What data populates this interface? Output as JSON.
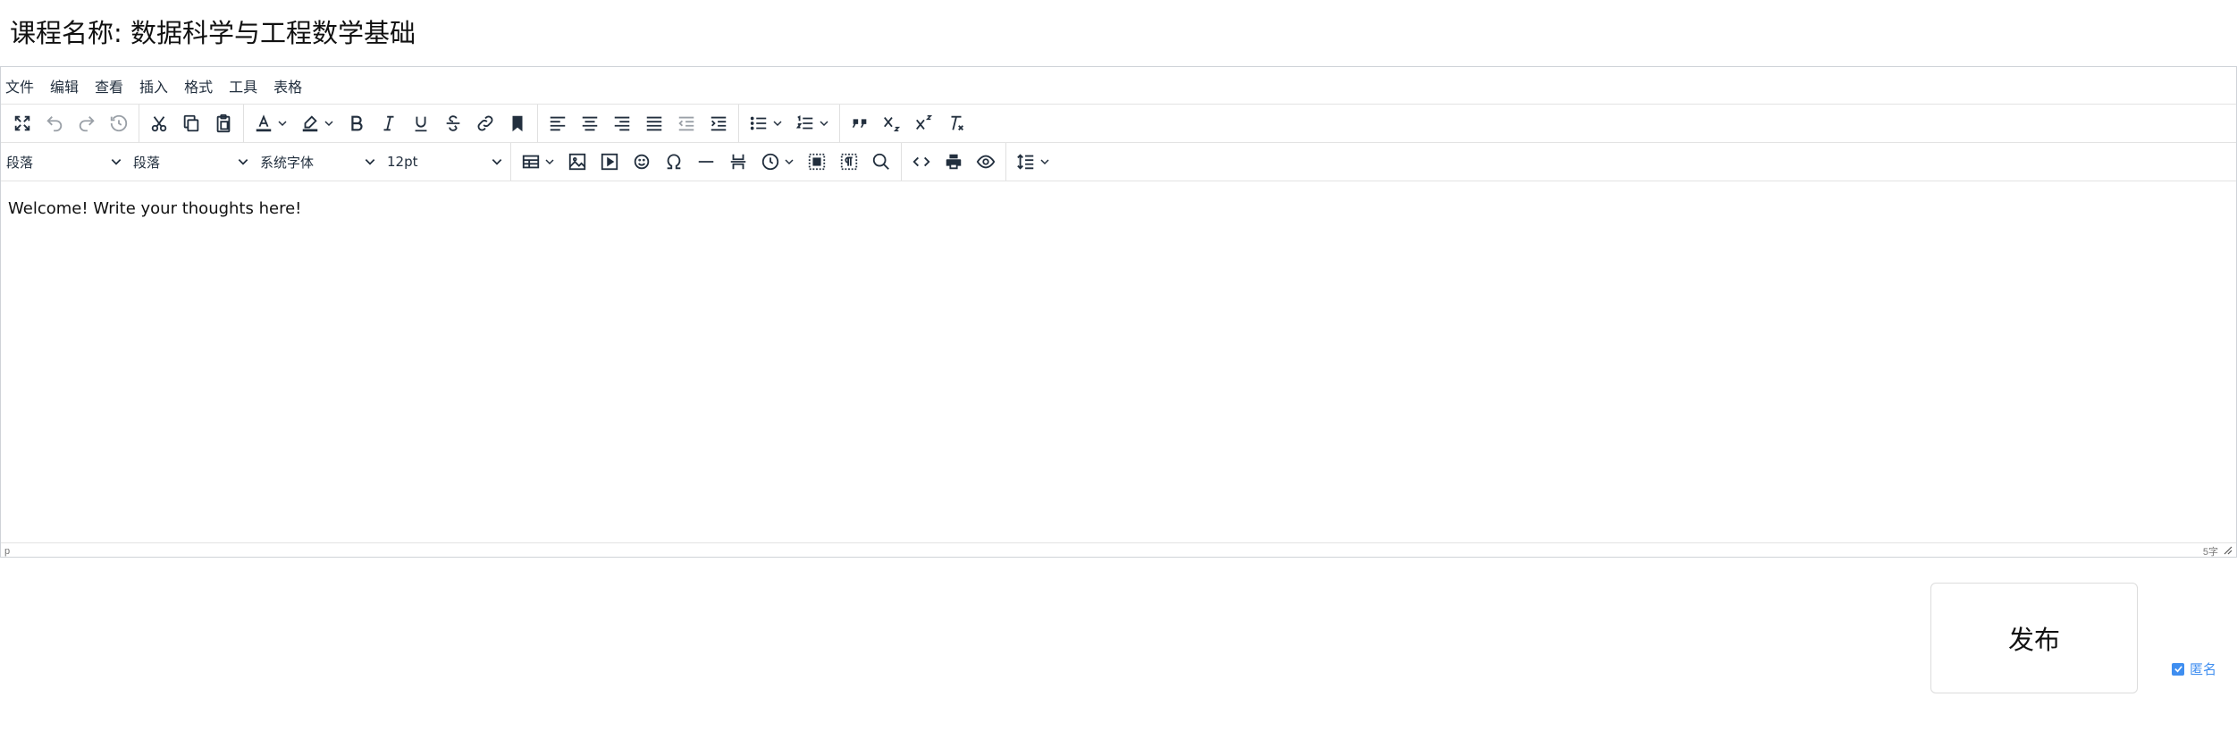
{
  "page": {
    "title": "课程名称: 数据科学与工程数学基础"
  },
  "editor": {
    "menubar": [
      "文件",
      "编辑",
      "查看",
      "插入",
      "格式",
      "工具",
      "表格"
    ],
    "selects": {
      "block_format": "段落",
      "paragraph": "段落",
      "font_family": "系统字体",
      "font_size": "12pt"
    },
    "content": "Welcome! Write your thoughts here!",
    "status": {
      "path": "p",
      "word_count": "5字"
    }
  },
  "actions": {
    "publish_label": "发布",
    "anonymous_label": "匿名",
    "anonymous_checked": true
  },
  "colors": {
    "accent": "#3f8ef0",
    "border": "#cfd3d8",
    "text": "#222f3e"
  }
}
